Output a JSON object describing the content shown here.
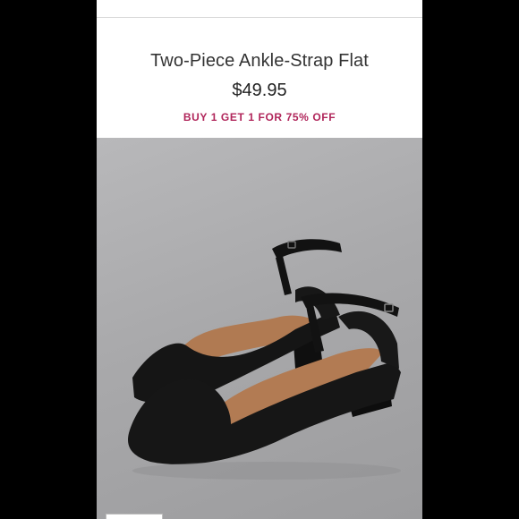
{
  "product": {
    "title": "Two-Piece Ankle-Strap Flat",
    "price": "$49.95",
    "promo": "BUY 1 GET 1 FOR 75% OFF"
  },
  "image": {
    "subject": "black-ankle-strap-flat-pair",
    "background": "#a9a9ab"
  },
  "colors": {
    "promo": "#b0255a",
    "shoe": "#141414",
    "lining": "#b07a52"
  }
}
